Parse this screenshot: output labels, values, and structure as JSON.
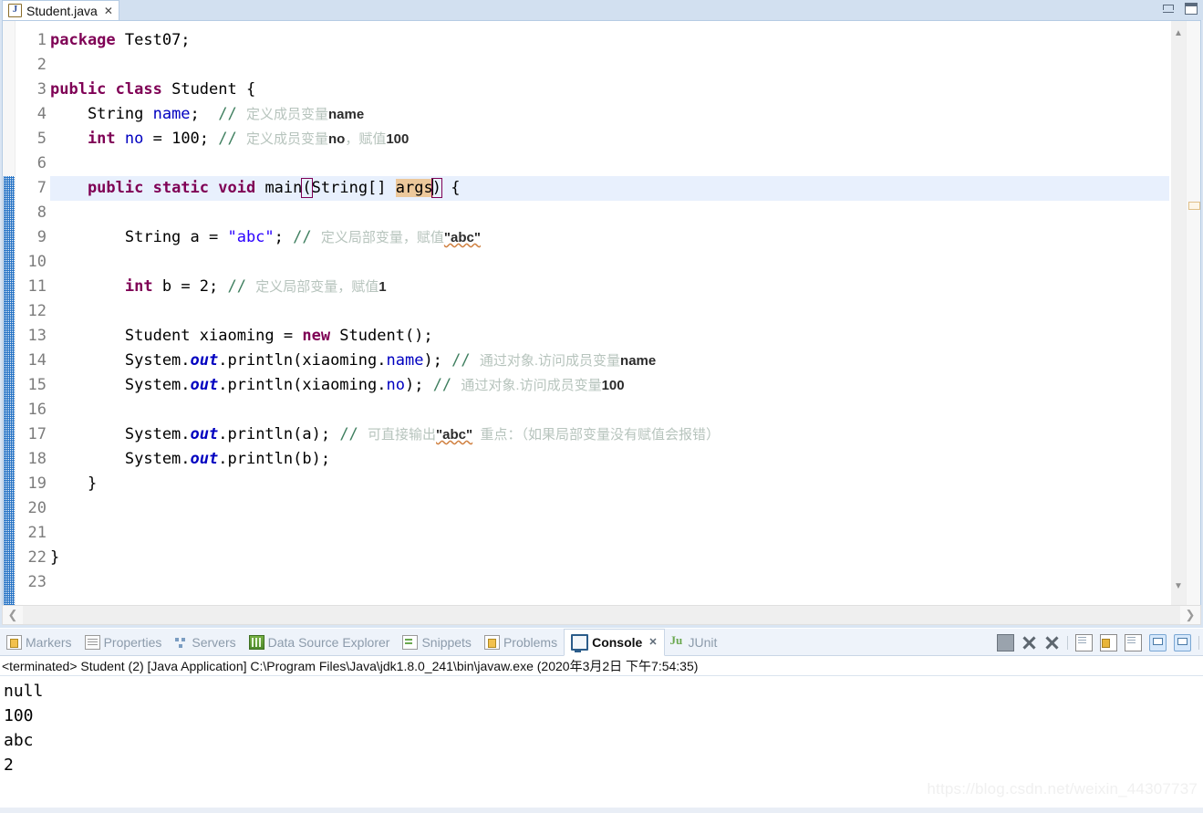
{
  "window": {
    "minimize_label": "Minimize",
    "maximize_label": "Maximize"
  },
  "editor": {
    "tab": {
      "title": "Student.java",
      "close": "✕",
      "icon": "java-file-icon"
    },
    "line_numbers": [
      "1",
      "2",
      "3",
      "4",
      "5",
      "6",
      "7",
      "8",
      "9",
      "10",
      "11",
      "12",
      "13",
      "14",
      "15",
      "16",
      "17",
      "18",
      "19",
      "20",
      "21",
      "22",
      "23"
    ],
    "current_line": 7,
    "fold_line": 7,
    "code": {
      "l1_kw": "package",
      "l1_rest": " Test07;",
      "l3_kw1": "public",
      "l3_kw2": "class",
      "l3_rest": " Student {",
      "l4_type": "    String ",
      "l4_field": "name",
      "l4_semi": ";  ",
      "l4_cmt": "// ",
      "l4_cmt_cn": "定义成员变量",
      "l4_cmt_b": "name",
      "l5_kw": "    int ",
      "l5_field": "no",
      "l5_rest": " = 100; ",
      "l5_cmt": "// ",
      "l5_cmt_cn": "定义成员变量",
      "l5_cmt_b1": "no",
      "l5_cmt_cn2": "，赋值",
      "l5_cmt_b2": "100",
      "l7_kw1": "    public ",
      "l7_kw2": "static ",
      "l7_kw3": "void ",
      "l7_name": "main",
      "l7_paren1": "(",
      "l7_args_type": "String[] ",
      "l7_args": "args",
      "l7_paren2": ")",
      "l7_tail": " {",
      "l9_indent": "        String a = ",
      "l9_str": "\"abc\"",
      "l9_semi": "; ",
      "l9_cmt": "// ",
      "l9_cmt_cn": "定义局部变量，赋值",
      "l9_cmt_b": "\"abc\"",
      "l11_indent": "        ",
      "l11_kw": "int",
      "l11_rest": " b = 2; ",
      "l11_cmt": "// ",
      "l11_cmt_cn": "定义局部变量，赋值",
      "l11_cmt_b": "1",
      "l13_a": "        Student xiaoming = ",
      "l13_kw": "new",
      "l13_b": " Student();",
      "l14_a": "        System.",
      "l14_out": "out",
      "l14_b": ".println(xiaoming.",
      "l14_field": "name",
      "l14_c": "); ",
      "l14_cmt": "// ",
      "l14_cmt_cn": "通过对象.访问成员变量",
      "l14_cmt_b": "name",
      "l15_a": "        System.",
      "l15_out": "out",
      "l15_b": ".println(xiaoming.",
      "l15_field": "no",
      "l15_c": "); ",
      "l15_cmt": "// ",
      "l15_cmt_cn": "通过对象.访问成员变量",
      "l15_cmt_b": "100",
      "l17_a": "        System.",
      "l17_out": "out",
      "l17_b": ".println(a); ",
      "l17_cmt": "// ",
      "l17_cmt_cn": "可直接输出",
      "l17_cmt_b": "\"abc\"",
      "l17_cmt_cn2": "  重点：（如果局部变量没有赋值会报错）",
      "l18_a": "        System.",
      "l18_out": "out",
      "l18_b": ".println(b);",
      "l19": "    }",
      "l22": "}"
    },
    "scrollbar": {
      "up_arrow": "▲",
      "down_arrow": "▼",
      "left_arrow": "❮",
      "right_arrow": "❯"
    }
  },
  "console_part": {
    "tabs": [
      {
        "label": "Markers",
        "icon": "markers-icon",
        "active": false,
        "closable": false
      },
      {
        "label": "Properties",
        "icon": "properties-icon",
        "active": false,
        "closable": false
      },
      {
        "label": "Servers",
        "icon": "servers-icon",
        "active": false,
        "closable": false
      },
      {
        "label": "Data Source Explorer",
        "icon": "database-icon",
        "active": false,
        "closable": false
      },
      {
        "label": "Snippets",
        "icon": "snippets-icon",
        "active": false,
        "closable": false
      },
      {
        "label": "Problems",
        "icon": "problems-icon",
        "active": false,
        "closable": false
      },
      {
        "label": "Console",
        "icon": "console-icon",
        "active": true,
        "closable": true
      },
      {
        "label": "JUnit",
        "icon": "junit-icon",
        "active": false,
        "closable": false
      }
    ],
    "tab_close_glyph": "✕",
    "toolbar": [
      {
        "name": "terminate-button",
        "icon": "stop-square-icon"
      },
      {
        "name": "remove-launch-button",
        "icon": "x-icon"
      },
      {
        "name": "remove-all-terminated-button",
        "icon": "double-x-icon"
      },
      {
        "name": "clear-console-button",
        "icon": "clear-document-icon"
      },
      {
        "name": "scroll-lock-button",
        "icon": "lock-icon"
      },
      {
        "name": "word-wrap-button",
        "icon": "wrap-document-icon"
      },
      {
        "name": "pin-console-button",
        "icon": "pin-console-icon"
      },
      {
        "name": "display-selected-console-button",
        "icon": "select-console-icon"
      }
    ],
    "status_line": "<terminated> Student (2) [Java Application] C:\\Program Files\\Java\\jdk1.8.0_241\\bin\\javaw.exe (2020年3月2日 下午7:54:35)",
    "output": [
      "null",
      "100",
      "abc",
      "2"
    ]
  },
  "watermark": "https://blog.csdn.net/weixin_44307737"
}
